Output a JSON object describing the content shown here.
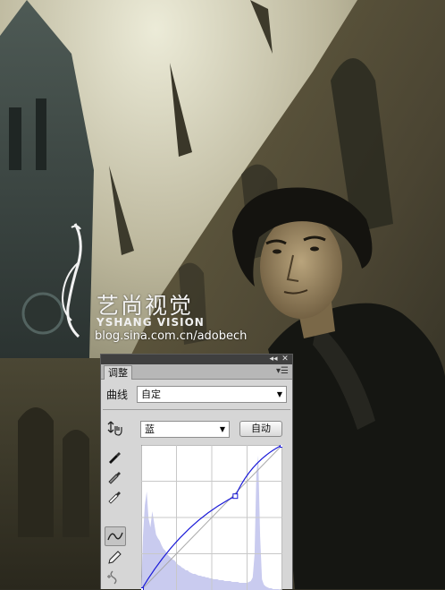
{
  "watermark": {
    "brand_cn": "艺尚视觉",
    "brand_en": "YSHANG VISION",
    "url": "blog.sina.com.cn/adobech"
  },
  "panel": {
    "collapse_glyph": "◂◂",
    "close_glyph": "✕",
    "tab_label": "调整",
    "menu_glyph": "▾☰",
    "adjustment_type_label": "曲线",
    "preset": "自定",
    "channel": "蓝",
    "auto_button_label": "自动",
    "tools": [
      "on-image-adjust-icon",
      "black-point-eyedropper-icon",
      "gray-point-eyedropper-icon",
      "white-point-eyedropper-icon",
      "curve-edit-icon",
      "pencil-draw-icon",
      "smooth-curve-icon"
    ],
    "curve": {
      "points": [
        [
          0,
          0
        ],
        [
          170,
          165
        ],
        [
          255,
          255
        ]
      ],
      "grid_divisions": 4
    },
    "colors": {
      "curve": "#1a1ad8",
      "histogram": "#c9cbef",
      "graph_bg": "#ffffff",
      "panel_bg": "#d6d6d6"
    }
  }
}
